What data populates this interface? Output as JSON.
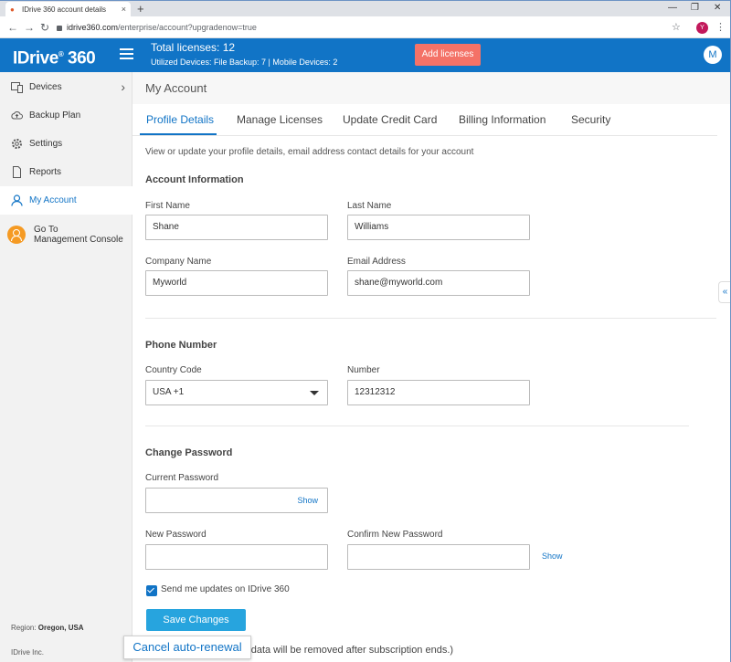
{
  "browser": {
    "tab_title": "IDrive 360 account details",
    "tab_close": "×",
    "new_tab": "+",
    "url_domain": "idrive360.com",
    "url_path": "/enterprise/account?upgradenow=true",
    "profile_initial": "Y"
  },
  "header": {
    "logo_text": "IDrive",
    "logo_suffix": "360",
    "licenses_title": "Total licenses: 12",
    "utilized_text": "Utilized Devices: File Backup: 7 |  Mobile Devices: 2",
    "add_licenses_label": "Add licenses",
    "avatar_initial": "M",
    "accent_color": "#1174c6",
    "button_color": "#f47267"
  },
  "sidebar": {
    "items": [
      {
        "label": "Devices",
        "icon": "devices-icon"
      },
      {
        "label": "Backup Plan",
        "icon": "cloud-upload-icon"
      },
      {
        "label": "Settings",
        "icon": "gear-icon"
      },
      {
        "label": "Reports",
        "icon": "document-icon"
      },
      {
        "label": "My Account",
        "icon": "user-icon"
      }
    ],
    "goto_line1": "Go To",
    "goto_line2": "Management Console",
    "region_label": "Region: ",
    "region_value": "Oregon, USA",
    "copyright": "IDrive Inc."
  },
  "main": {
    "title": "My Account",
    "tabs": [
      "Profile Details",
      "Manage Licenses",
      "Update Credit Card",
      "Billing Information",
      "Security"
    ],
    "description": "View or update your profile details, email address contact details for your account",
    "account_section": "Account Information",
    "first_name_label": "First Name",
    "first_name_value": "Shane",
    "last_name_label": "Last Name",
    "last_name_value": "Williams",
    "company_label": "Company Name",
    "company_value": "Myworld",
    "email_label": "Email Address",
    "email_value": "shane@myworld.com",
    "phone_section": "Phone Number",
    "country_label": "Country Code",
    "country_value": "USA +1",
    "number_label": "Number",
    "number_value": "12312312",
    "password_section": "Change Password",
    "current_pw_label": "Current Password",
    "new_pw_label": "New Password",
    "confirm_pw_label": "Confirm New Password",
    "show_label": "Show",
    "updates_checkbox_label": "Send me updates on IDrive 360",
    "save_label": "Save Changes",
    "cancel_renewal_label": "Cancel auto-renewal",
    "notice_text": "r data will be removed after subscription ends.)"
  }
}
